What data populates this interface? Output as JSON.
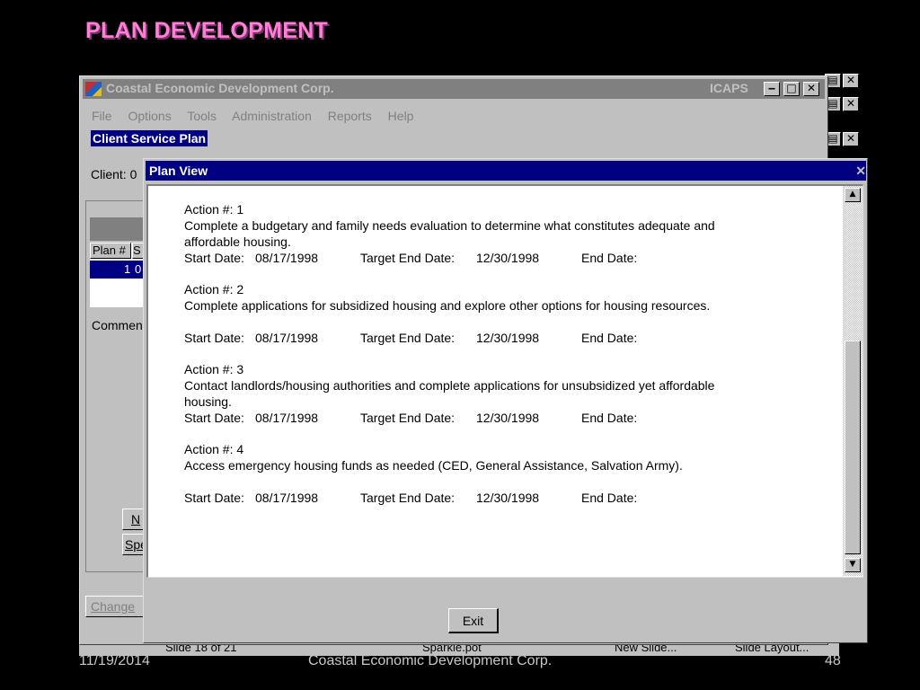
{
  "slide": {
    "title": "PLAN DEVELOPMENT",
    "footer_date": "11/19/2014",
    "footer_org": "Coastal Economic Development Corp.",
    "footer_page": "48"
  },
  "app": {
    "title": "Coastal Economic Development Corp.",
    "right_label": "ICAPS",
    "menu": [
      "File",
      "Options",
      "Tools",
      "Administration",
      "Reports",
      "Help"
    ],
    "doc_title": "Client Service Plan",
    "client_label": "Client:  0",
    "plan_col": "Plan #",
    "plan_col2": "S",
    "plan_row_value": "1",
    "plan_row_col2": "0",
    "comments_label": "Commen",
    "btn_new": "N",
    "btn_spe": "Spe",
    "btn_change": "Change"
  },
  "ppt_status": {
    "slide_count": "Slide 18 of 21",
    "template": "Sparkle.pot",
    "new_slide": "New Slide...",
    "slide_layout": "Slide Layout..."
  },
  "dialog": {
    "title": "Plan View",
    "exit_label": "Exit",
    "start_label": "Start Date:",
    "target_label": "Target End Date:",
    "end_label": "End Date:",
    "actions": [
      {
        "label": "Action #:   1",
        "desc1": "Complete a budgetary and family needs evaluation to determine what constitutes adequate and",
        "desc2": "affordable housing.",
        "start": "08/17/1998",
        "target": "12/30/1998"
      },
      {
        "label": "Action #:   2",
        "desc1": "Complete applications for subsidized housing and explore other options for housing resources.",
        "desc2": "",
        "start": "08/17/1998",
        "target": "12/30/1998"
      },
      {
        "label": "Action #:   3",
        "desc1": "Contact landlords/housing authorities and complete applications for unsubsidized yet affordable",
        "desc2": "housing.",
        "start": "08/17/1998",
        "target": "12/30/1998"
      },
      {
        "label": "Action #:   4",
        "desc1": "Access emergency housing funds as needed (CED, General Assistance, Salvation Army).",
        "desc2": "",
        "start": "08/17/1998",
        "target": "12/30/1998"
      }
    ]
  }
}
